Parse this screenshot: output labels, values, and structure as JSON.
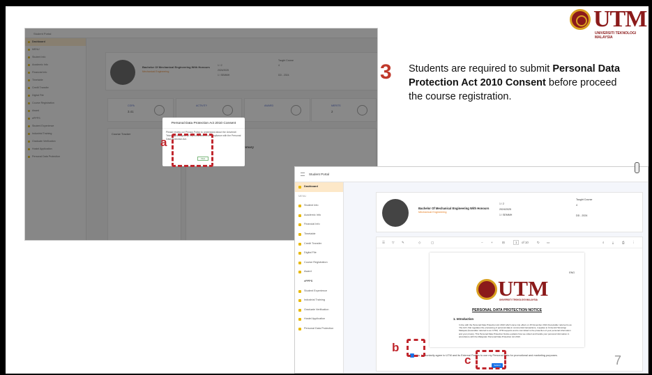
{
  "logo": {
    "text": "UTM",
    "subtitle": "UNIVERSITI TEKNOLOGI MALAYSIA"
  },
  "step": {
    "number": "3",
    "text_before": "Students are required to submit ",
    "text_bold": "Personal Data Protection Act 2010 Consent",
    "text_after": " before proceed the course registration."
  },
  "page_number": "7",
  "callouts": {
    "a": "a",
    "b": "b",
    "c": "c"
  },
  "portal": {
    "title": "Student Portal",
    "program": "Bachelor Of Mechanical Engineering With Honours",
    "faculty": "Mechanical Engineering",
    "year": "1 / 2",
    "session": "2024/2025",
    "sem": "1 / SEMMH",
    "course_type": "Taught Course",
    "credits": "4",
    "code": "DD - 2024",
    "sidebar": [
      "Dashboard",
      "MENU",
      "Student Info",
      "Academic Info",
      "Financial Info",
      "Timetable",
      "Credit Transfer",
      "Digital File",
      "Course Registration",
      "Award",
      "ePPPS",
      "Student Experience",
      "Industrial Training",
      "Graduate Verification",
      "Hostel Application",
      "Personal Data Protection"
    ]
  },
  "shot1": {
    "stats": [
      {
        "label": "CGPA",
        "value": "3.41"
      },
      {
        "label": "ACTIVITY",
        "value": ""
      },
      {
        "label": "AWARD",
        "value": ""
      },
      {
        "label": "MERITS",
        "value": "2"
      }
    ],
    "course_tracker": "Course Tracker",
    "cgpa_summary": "CGPA Summary",
    "modal_title": "Personal Data Protection Act 2010 Consent",
    "modal_body": "Please review our Privacy Policy to understand about the Universiti Teknologi Malaysia (UTM) commitment to compliance with the Personal Data Protection Act.",
    "modal_button": "View"
  },
  "shot2": {
    "toolbar_page": "1",
    "toolbar_of": "of 10",
    "pdf_ver": "ENG",
    "pdf_title": "PERSONAL DATA PROTECTION NOTICE",
    "pdf_section": "1.  Introduction",
    "pdf_body": "In line with the Personal Data Protection Act 2010 which came into effect on 15 November 2013 (hereinafter referred to as \"the Act\") that regulates the processing of personal data in commercial transactions, it applies to Universiti Teknologi Malaysia (hereinafter referred to as 'UTM'). UTM supports and is committed to the protection of your personal information and your privacy. This Personal Data Protection Notice explains how we collect and handle your personal information in accordance with the Malaysian Personal Data Protection Act 2010.",
    "consent": "Yes, I voluntarily agree to UTM and its External Parties to use my Personal Data for promotional and marketing purposes.",
    "submit": "Submit"
  }
}
